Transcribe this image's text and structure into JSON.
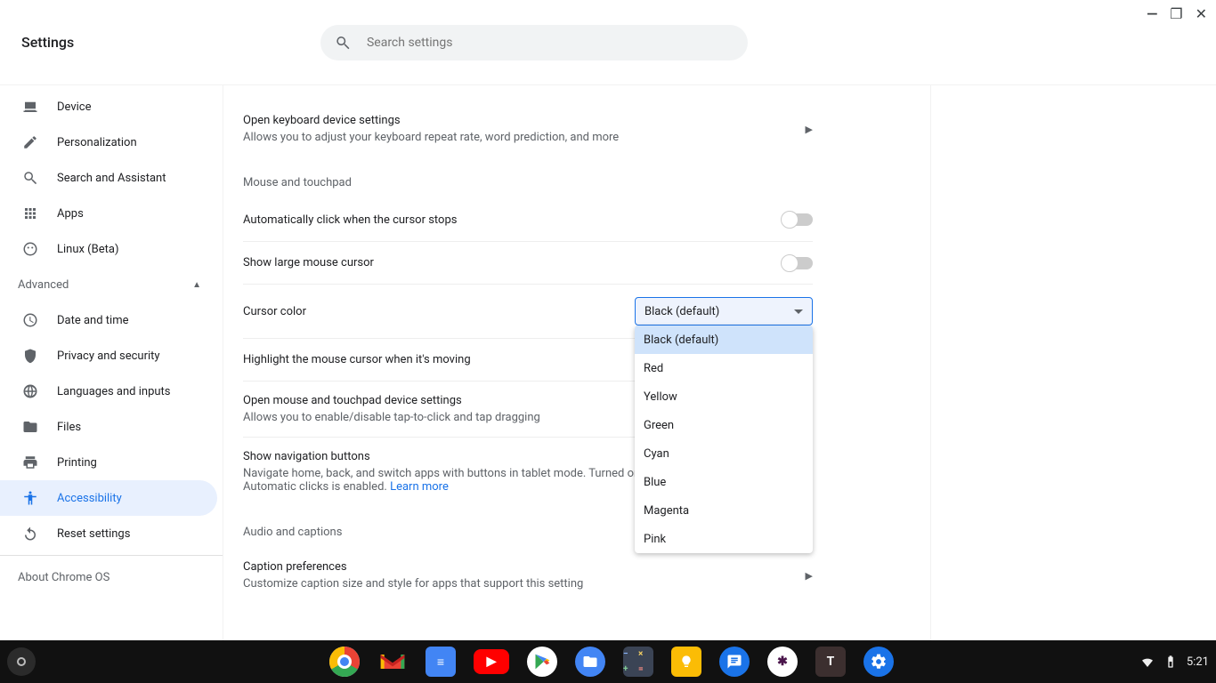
{
  "window": {
    "minimize": "—",
    "maximize": "❐",
    "close": "✕"
  },
  "header": {
    "title": "Settings",
    "search_placeholder": "Search settings"
  },
  "sidebar": {
    "items": [
      {
        "label": "Device"
      },
      {
        "label": "Personalization"
      },
      {
        "label": "Search and Assistant"
      },
      {
        "label": "Apps"
      },
      {
        "label": "Linux (Beta)"
      }
    ],
    "advanced_label": "Advanced",
    "advanced_items": [
      {
        "label": "Date and time"
      },
      {
        "label": "Privacy and security"
      },
      {
        "label": "Languages and inputs"
      },
      {
        "label": "Files"
      },
      {
        "label": "Printing"
      },
      {
        "label": "Accessibility"
      },
      {
        "label": "Reset settings"
      }
    ],
    "about": "About Chrome OS"
  },
  "content": {
    "keyboard_row": {
      "label": "Open keyboard device settings",
      "sub": "Allows you to adjust your keyboard repeat rate, word prediction, and more"
    },
    "section_mouse": "Mouse and touchpad",
    "rows": {
      "autoclick": {
        "label": "Automatically click when the cursor stops"
      },
      "large_cursor": {
        "label": "Show large mouse cursor"
      },
      "cursor_color": {
        "label": "Cursor color",
        "value": "Black (default)"
      },
      "highlight_cursor": {
        "label": "Highlight the mouse cursor when it's moving"
      },
      "open_mouse": {
        "label": "Open mouse and touchpad device settings",
        "sub": "Allows you to enable/disable tap-to-click and tap dragging"
      },
      "nav_buttons": {
        "label": "Show navigation buttons",
        "sub": "Navigate home, back, and switch apps with buttons in tablet mode. Turned on when switch access or Automatic clicks is enabled.  ",
        "learn_more": "Learn more"
      }
    },
    "cursor_color_options": [
      "Black (default)",
      "Red",
      "Yellow",
      "Green",
      "Cyan",
      "Blue",
      "Magenta",
      "Pink"
    ],
    "section_audio": "Audio and captions",
    "caption_row": {
      "label": "Caption preferences",
      "sub": "Customize caption size and style for apps that support this setting"
    }
  },
  "shelf": {
    "time": "5:21"
  }
}
